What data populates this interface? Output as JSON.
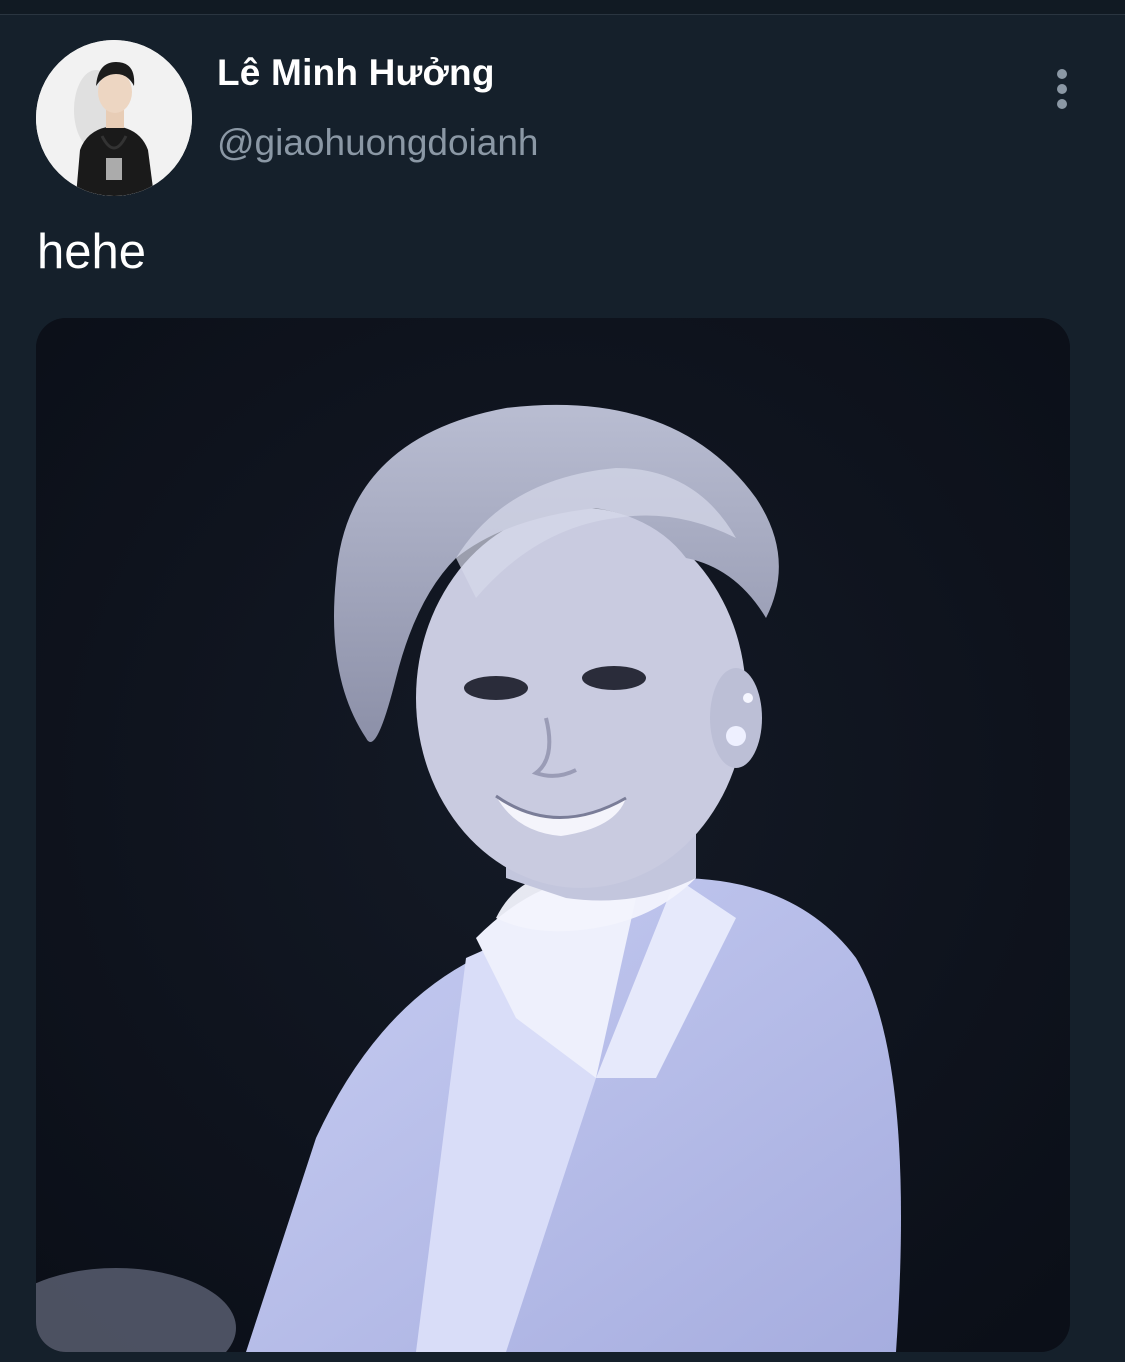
{
  "tweet": {
    "author": {
      "display_name": "Lê Minh Hưởng",
      "handle": "@giaohuongdoianh",
      "avatar": "profile-photo"
    },
    "text": "hehe",
    "media": {
      "type": "photo",
      "icon": "photo"
    },
    "more_icon": "more-vertical-icon"
  },
  "colors": {
    "background": "#15202b",
    "primary_text": "#ffffff",
    "secondary_text": "#8b98a5"
  }
}
